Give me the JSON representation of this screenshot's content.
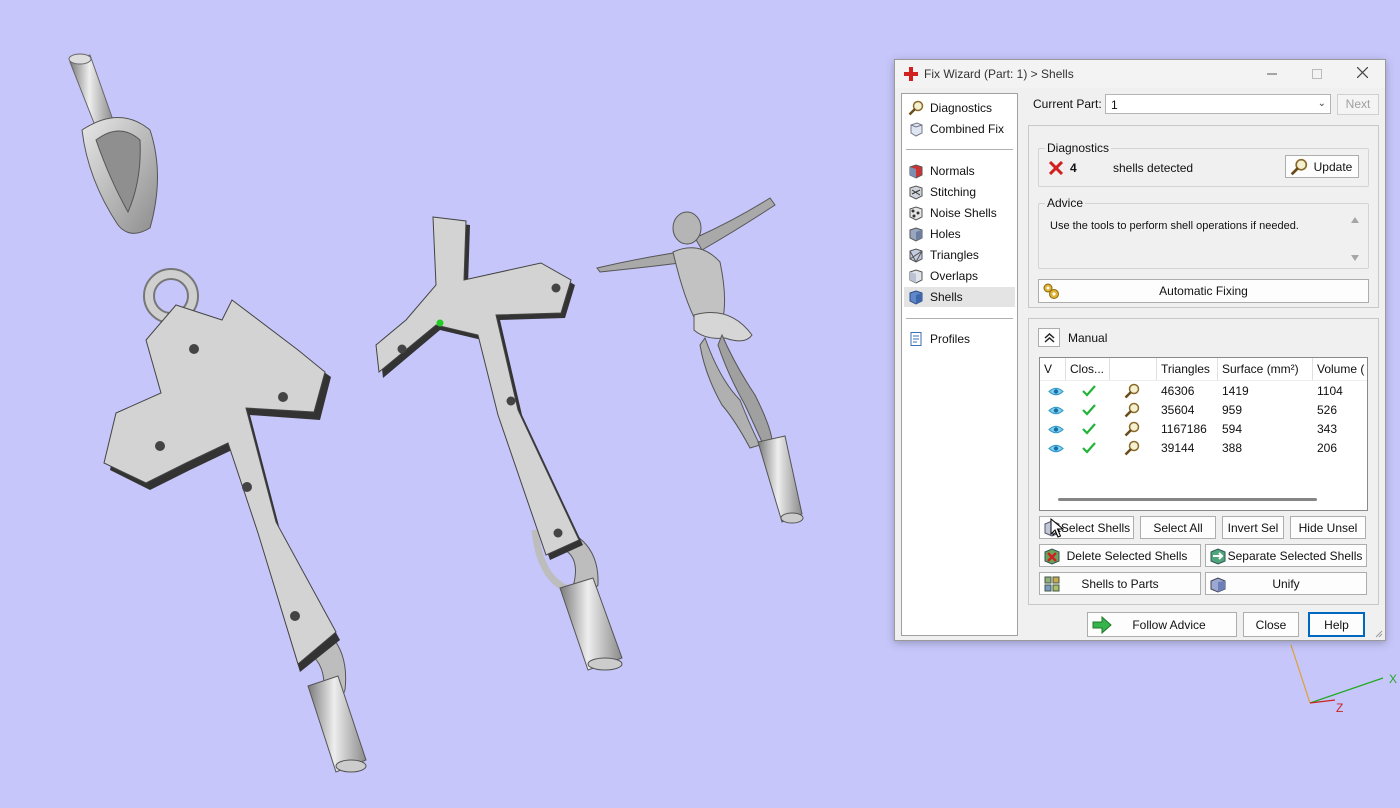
{
  "viewport": {
    "background": "#c6c6fa",
    "axes": {
      "x_label": "X",
      "z_label": "Z"
    }
  },
  "dialog": {
    "title": "Fix Wizard (Part: 1) > Shells",
    "icons": {
      "app": "red-cross-icon",
      "minimize": "minimize-icon",
      "maximize": "maximize-icon",
      "close": "close-icon"
    },
    "nav": {
      "groups": [
        [
          {
            "label": "Diagnostics",
            "icon": "magnifier-icon"
          },
          {
            "label": "Combined Fix",
            "icon": "cube-icon"
          }
        ],
        [
          {
            "label": "Normals",
            "icon": "normals-icon"
          },
          {
            "label": "Stitching",
            "icon": "stitching-icon"
          },
          {
            "label": "Noise Shells",
            "icon": "noise-shells-icon"
          },
          {
            "label": "Holes",
            "icon": "holes-icon"
          },
          {
            "label": "Triangles",
            "icon": "triangles-icon"
          },
          {
            "label": "Overlaps",
            "icon": "overlaps-icon"
          },
          {
            "label": "Shells",
            "icon": "shells-icon",
            "selected": true
          }
        ],
        [
          {
            "label": "Profiles",
            "icon": "document-icon"
          }
        ]
      ]
    },
    "current_part": {
      "label": "Current Part:",
      "value": "1"
    },
    "next_label": "Next",
    "diagnostics": {
      "title": "Diagnostics",
      "status_icon": "red-x-icon",
      "count": "4",
      "text": "shells detected",
      "update_label": "Update"
    },
    "advice": {
      "title": "Advice",
      "text": "Use the tools to perform shell operations if needed."
    },
    "automatic_fixing_label": "Automatic Fixing",
    "manual": {
      "label": "Manual",
      "table": {
        "headers": [
          "V",
          "Clos...",
          "",
          "Triangles",
          "Surface (mm²)",
          "Volume ("
        ],
        "rows": [
          {
            "triangles": "46306",
            "surface": "1419",
            "volume": "1104"
          },
          {
            "triangles": "35604",
            "surface": "959",
            "volume": "526"
          },
          {
            "triangles": "1167186",
            "surface": "594",
            "volume": "343"
          },
          {
            "triangles": "39144",
            "surface": "388",
            "volume": "206"
          }
        ],
        "row_icons": [
          "eye-icon",
          "green-check-icon",
          "zoom-icon"
        ]
      },
      "buttons": {
        "select_shells": "Select Shells",
        "select_all": "Select All",
        "invert_sel": "Invert Sel",
        "hide_unsel": "Hide Unsel",
        "delete_selected": "Delete Selected Shells",
        "separate_selected": "Separate Selected Shells",
        "shells_to_parts": "Shells to Parts",
        "unify": "Unify"
      }
    },
    "footer": {
      "follow_advice": "Follow Advice",
      "close": "Close",
      "help": "Help"
    },
    "colors": {
      "accent_blue": "#0067c0",
      "red": "#d21f1f",
      "green": "#22b33a",
      "dialog_bg": "#f0f0f0"
    }
  }
}
